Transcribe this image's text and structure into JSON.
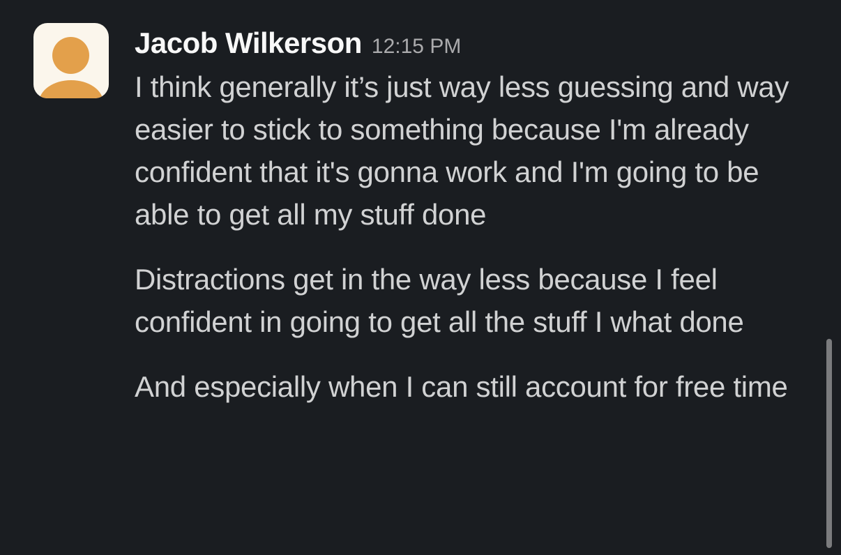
{
  "message": {
    "author": "Jacob Wilkerson",
    "timestamp": "12:15 PM",
    "paragraphs": [
      "I think generally it’s just way less guessing and way easier to stick to something because I'm already confident that it's gonna work and I'm going to be able to get all my stuff done",
      "Distractions get in the way less because I feel confident in going to get all the stuff I what done",
      "And especially when I can still account for free time"
    ]
  },
  "colors": {
    "background": "#1a1d21",
    "avatar_background": "#fbf6ec",
    "avatar_figure": "#e3a04b",
    "author_text": "#f8f8f8",
    "body_text": "#d1d2d3",
    "timestamp_text": "#ababad",
    "scrollbar": "#7b7c7e"
  },
  "icons": {
    "avatar": "user-avatar-icon"
  }
}
